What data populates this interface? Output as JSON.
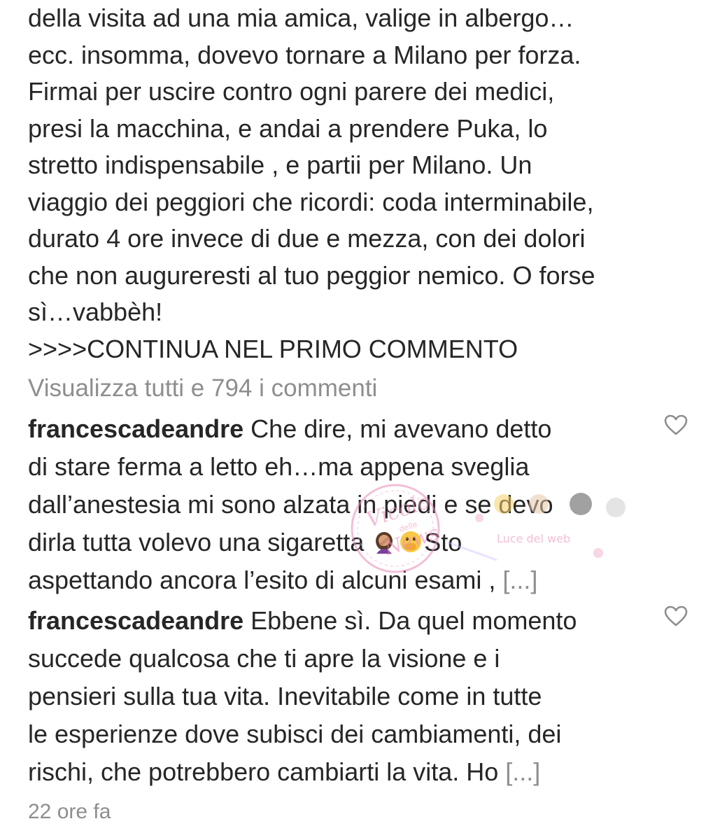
{
  "caption": {
    "lines": [
      "della visita ad una mia amica, valige in albergo…",
      "ecc. insomma, dovevo tornare a Milano per forza.",
      "Firmai per uscire contro ogni parere dei medici,",
      "presi la macchina, e andai a prendere Puka, lo",
      "stretto indispensabile , e partii per Milano. Un",
      "viaggio dei peggiori che ricordi: coda interminabile,",
      "durato 4 ore invece di due e mezza, con dei dolori",
      "che non augureresti al tuo peggior nemico. O forse",
      "sì…vabbèh!",
      ">>>>CONTINUA NEL PRIMO COMMENTO"
    ]
  },
  "view_all_comments": "Visualizza tutti e 794 i commenti",
  "comments": [
    {
      "username": "francescadeandre",
      "lines": [
        " Che dire, mi avevano detto",
        "di stare ferma a letto eh…ma appena sveglia",
        "dall’anestesia mi sono alzata in piedi e se devo",
        "dirla tutta volevo una sigaretta ",
        "Sto",
        "aspettando ancora l’esito di alcuni esami , "
      ],
      "more": "[...]",
      "emojis": [
        "woman-facepalming-emoji",
        "face-with-hand-over-mouth-emoji"
      ]
    },
    {
      "username": "francescadeandre",
      "lines": [
        " Ebbene sì. Da quel momento",
        "succede qualcosa che ti apre la visione e i",
        "pensieri sulla tua vita. Inevitabile come in tutte",
        "le esperienze dove subisci dei cambiamenti, dei",
        "rischi, che potrebbero cambiarti la vita. Ho "
      ],
      "more": "[...]"
    }
  ],
  "timestamp": "22 ore fa",
  "watermark": {
    "text": [
      "Vicolo",
      "delle",
      "News",
      "Luce del web"
    ]
  },
  "colors": {
    "text": "#262626",
    "secondary": "#8e8e8e",
    "heart_outline": "#8e8e8e",
    "watermark_pink": "#e98bb8"
  }
}
